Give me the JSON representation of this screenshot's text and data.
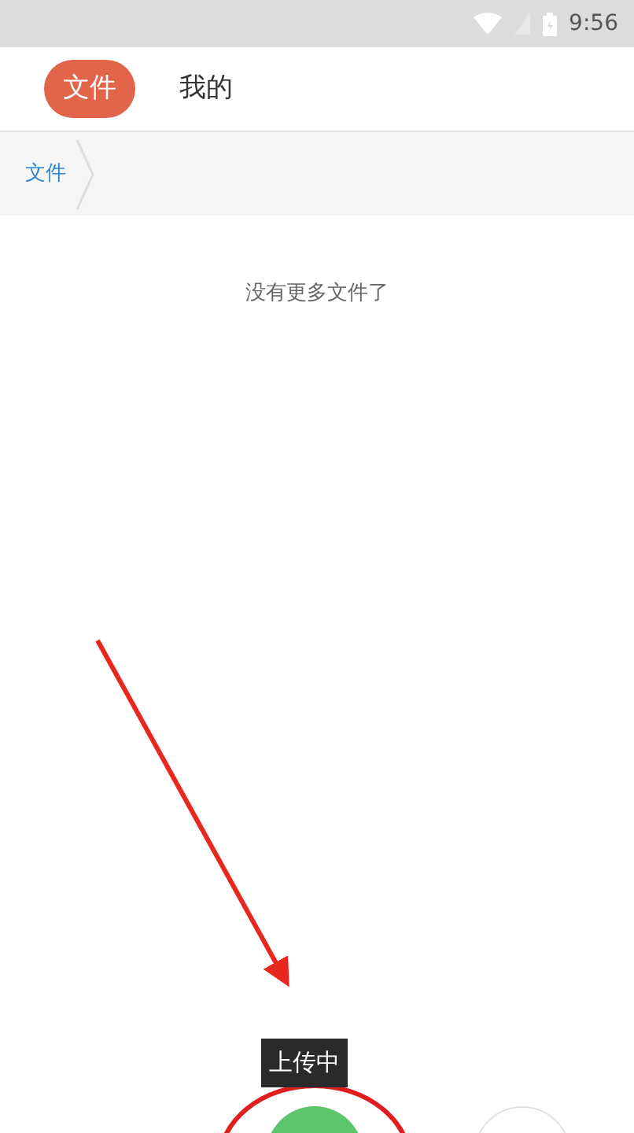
{
  "status_bar": {
    "time": "9:56"
  },
  "tabs": [
    {
      "label": "文件",
      "selected": true
    },
    {
      "label": "我的",
      "selected": false
    }
  ],
  "breadcrumb": [
    {
      "label": "文件"
    }
  ],
  "empty_message": "没有更多文件了",
  "upload_tooltip": "上传中"
}
